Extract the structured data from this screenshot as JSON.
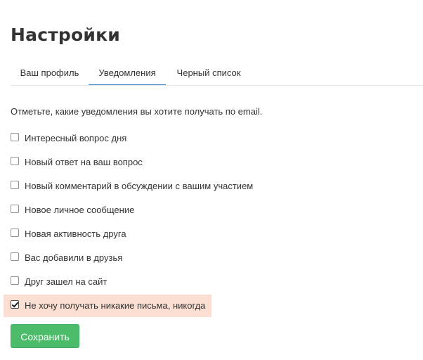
{
  "page_title": "Настройки",
  "tabs": [
    {
      "label": "Ваш профиль",
      "active": false
    },
    {
      "label": "Уведомления",
      "active": true
    },
    {
      "label": "Черный список",
      "active": false
    }
  ],
  "description": "Отметьте, какие уведомления вы хотите получать по email.",
  "options": [
    {
      "label": "Интересный вопрос дня",
      "checked": false
    },
    {
      "label": "Новый ответ на ваш вопрос",
      "checked": false
    },
    {
      "label": "Новый комментарий в обсуждении с вашим участием",
      "checked": false
    },
    {
      "label": "Новое личное сообщение",
      "checked": false
    },
    {
      "label": "Новая активность друга",
      "checked": false
    },
    {
      "label": "Вас добавили в друзья",
      "checked": false
    },
    {
      "label": "Друг зашел на сайт",
      "checked": false
    },
    {
      "label": "Не хочу получать никакие письма, никогда",
      "checked": true
    }
  ],
  "save_button": {
    "label": "Сохранить"
  },
  "colors": {
    "accent_green": "#4cbc6a",
    "active_tab_underline": "#3a7fc4",
    "highlight_background": "#fbdfd2"
  }
}
